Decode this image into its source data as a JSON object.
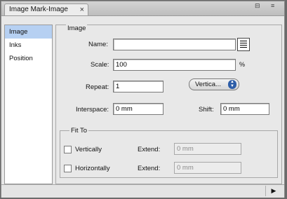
{
  "tab": {
    "title": "Image Mark-Image",
    "close": "×"
  },
  "window_controls": {
    "minimize": "⊟",
    "menu": "≡"
  },
  "sidebar": {
    "items": [
      {
        "label": "Image"
      },
      {
        "label": "Inks"
      },
      {
        "label": "Position"
      }
    ]
  },
  "image_group": {
    "title": "Image",
    "name_label": "Name:",
    "name_value": "",
    "scale_label": "Scale:",
    "scale_value": "100",
    "scale_unit": "%",
    "repeat_label": "Repeat:",
    "repeat_value": "1",
    "direction_value": "Vertica...",
    "interspace_label": "Interspace:",
    "interspace_value": "0 mm",
    "shift_label": "Shift:",
    "shift_value": "0 mm"
  },
  "fit_group": {
    "title": "Fit To",
    "vertically_label": "Vertically",
    "vertically_checked": false,
    "horizontally_label": "Horizontally",
    "horizontally_checked": false,
    "extend_label": "Extend:",
    "extend_v_value": "0 mm",
    "extend_h_value": "0 mm"
  },
  "footer": {
    "button": "▶"
  }
}
